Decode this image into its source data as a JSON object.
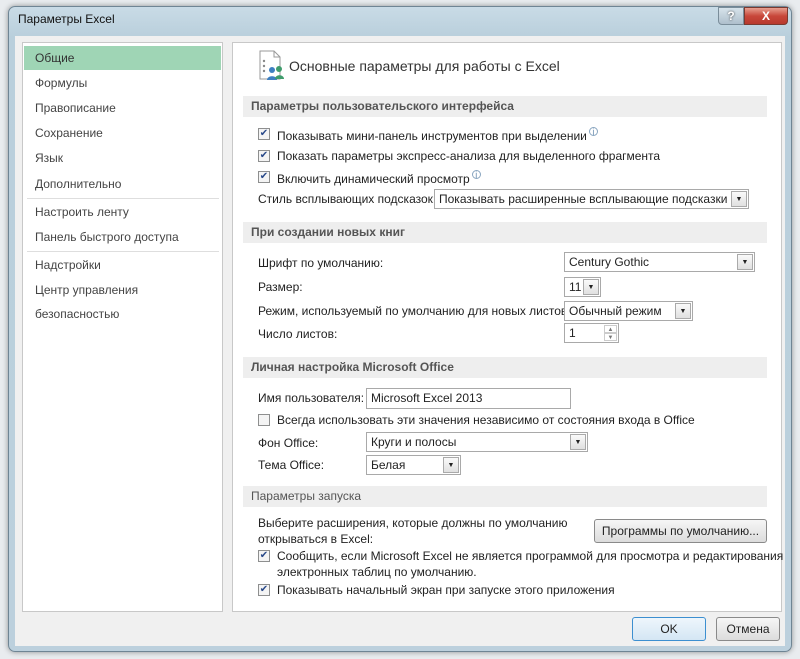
{
  "window": {
    "title": "Параметры Excel",
    "help_label": "?",
    "close_label": "X"
  },
  "sidebar": {
    "items": [
      {
        "label": "Общие",
        "selected": true
      },
      {
        "label": "Формулы"
      },
      {
        "label": "Правописание"
      },
      {
        "label": "Сохранение"
      },
      {
        "label": "Язык"
      },
      {
        "label": "Дополнительно"
      },
      {
        "label": "Настроить ленту"
      },
      {
        "label": "Панель быстрого доступа"
      },
      {
        "label": "Надстройки"
      },
      {
        "label": "Центр управления безопасностью"
      }
    ],
    "selected_color": "#9fd5b5"
  },
  "main": {
    "title": "Основные параметры для работы с Excel",
    "ui": {
      "header": "Параметры пользовательского интерфейса",
      "mini_toolbar": {
        "label": "Показывать мини-панель инструментов при выделении",
        "checked": true
      },
      "quick_analysis": {
        "label": "Показать параметры экспресс-анализа для выделенного фрагмента",
        "checked": true
      },
      "live_preview": {
        "label": "Включить динамический просмотр",
        "checked": true
      },
      "tooltip_style": {
        "label": "Стиль всплывающих подсказок:",
        "value": "Показывать расширенные всплывающие подсказки"
      }
    },
    "new_books": {
      "header": "При создании новых книг",
      "font": {
        "label": "Шрифт по умолчанию:",
        "value": "Century Gothic"
      },
      "size": {
        "label": "Размер:",
        "value": "11"
      },
      "view": {
        "label": "Режим, используемый по умолчанию для новых листов:",
        "value": "Обычный режим"
      },
      "sheets": {
        "label": "Число листов:",
        "value": "1"
      }
    },
    "personal": {
      "header": "Личная настройка Microsoft Office",
      "username": {
        "label": "Имя пользователя:",
        "value": "Microsoft Excel 2013"
      },
      "always_use": {
        "label": "Всегда использовать эти значения независимо от состояния входа в Office",
        "checked": false
      },
      "background": {
        "label": "Фон Office:",
        "value": "Круги и полосы"
      },
      "theme": {
        "label": "Тема Office:",
        "value": "Белая"
      }
    },
    "startup": {
      "header": "Параметры запуска",
      "extensions_line1": "Выберите расширения, которые должны по умолчанию",
      "extensions_line2": "открываться в Excel:",
      "default_programs_button": "Программы по умолчанию...",
      "notify": {
        "line1": "Сообщить, если Microsoft Excel не является программой для просмотра и редактирования",
        "line2": "электронных таблиц по умолчанию.",
        "checked": true
      },
      "start_screen": {
        "label": "Показывать начальный экран при запуске этого приложения",
        "checked": true
      }
    }
  },
  "footer": {
    "ok": "OK",
    "cancel": "Отмена"
  }
}
